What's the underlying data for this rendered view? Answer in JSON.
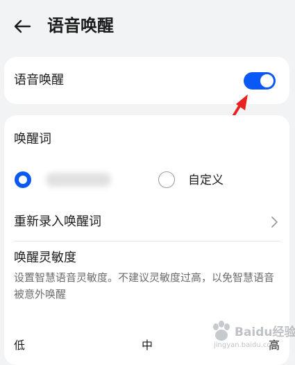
{
  "header": {
    "title": "语音唤醒"
  },
  "voice_wake": {
    "label": "语音唤醒",
    "enabled": true
  },
  "wake_word": {
    "section_label": "唤醒词",
    "options": [
      {
        "label": "",
        "selected": true
      },
      {
        "label": "自定义",
        "selected": false
      }
    ]
  },
  "rerecord": {
    "label": "重新录入唤醒词"
  },
  "sensitivity": {
    "title": "唤醒灵敏度",
    "description": "设置智慧语音灵敏度。不建议灵敏度过高，以免智慧语音被意外唤醒",
    "levels": [
      "低",
      "中",
      "高"
    ]
  },
  "watermark": {
    "text": "Baidu经验",
    "subtext": "jingyan.baidu.com"
  },
  "colors": {
    "accent": "#0a59f7",
    "annotation": "#e8231f"
  },
  "icons": {
    "back": "back-arrow-icon",
    "chevron": "chevron-right-icon"
  }
}
